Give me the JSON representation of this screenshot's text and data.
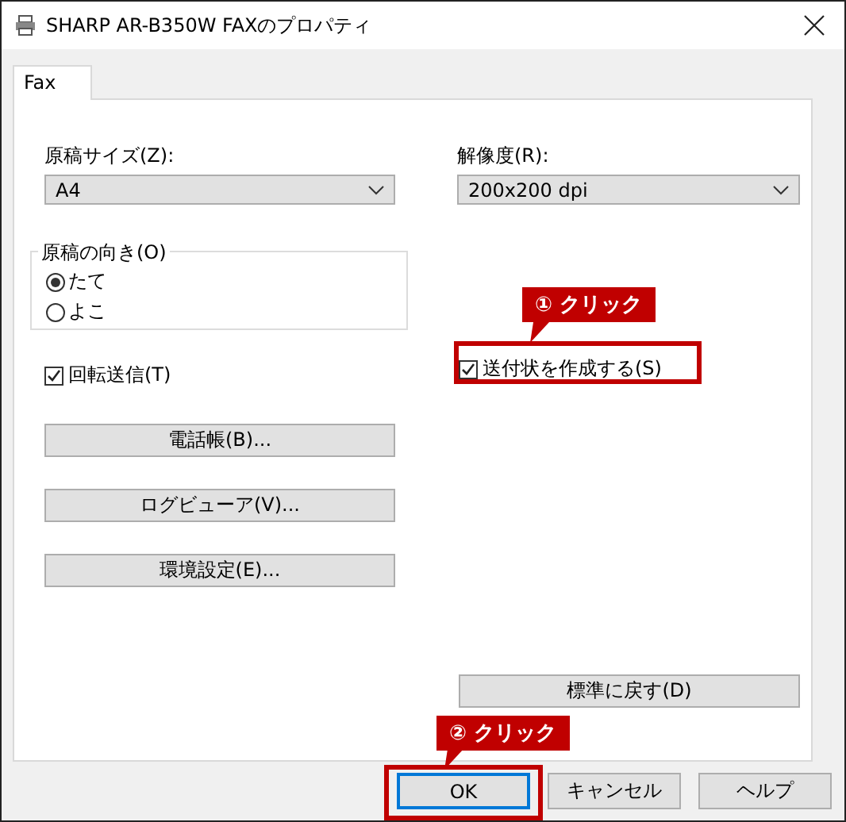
{
  "window": {
    "title": "SHARP AR-B350W FAXのプロパティ"
  },
  "tabs": [
    {
      "label": "Fax",
      "selected": true
    }
  ],
  "paper_size": {
    "label": "原稿サイズ(Z):",
    "value": "A4"
  },
  "resolution": {
    "label": "解像度(R):",
    "value": "200x200 dpi"
  },
  "orientation": {
    "label": "原稿の向き(O)",
    "options": [
      {
        "label": "たて",
        "selected": true
      },
      {
        "label": "よこ",
        "selected": false
      }
    ]
  },
  "rotate_send": {
    "label": "回転送信(T)",
    "checked": true
  },
  "cover_sheet": {
    "label": "送付状を作成する(S)",
    "checked": true
  },
  "buttons": [
    "電話帳(B)...",
    "ログビューア(V)...",
    "環境設定(E)..."
  ],
  "reset_button": "標準に戻す(D)",
  "dialog_buttons": [
    {
      "label": "OK",
      "default": true
    },
    {
      "label": "キャンセル",
      "default": false
    },
    {
      "label": "ヘルプ",
      "default": false
    }
  ],
  "annotations": [
    {
      "text": "① クリック"
    },
    {
      "text": "② クリック"
    }
  ]
}
